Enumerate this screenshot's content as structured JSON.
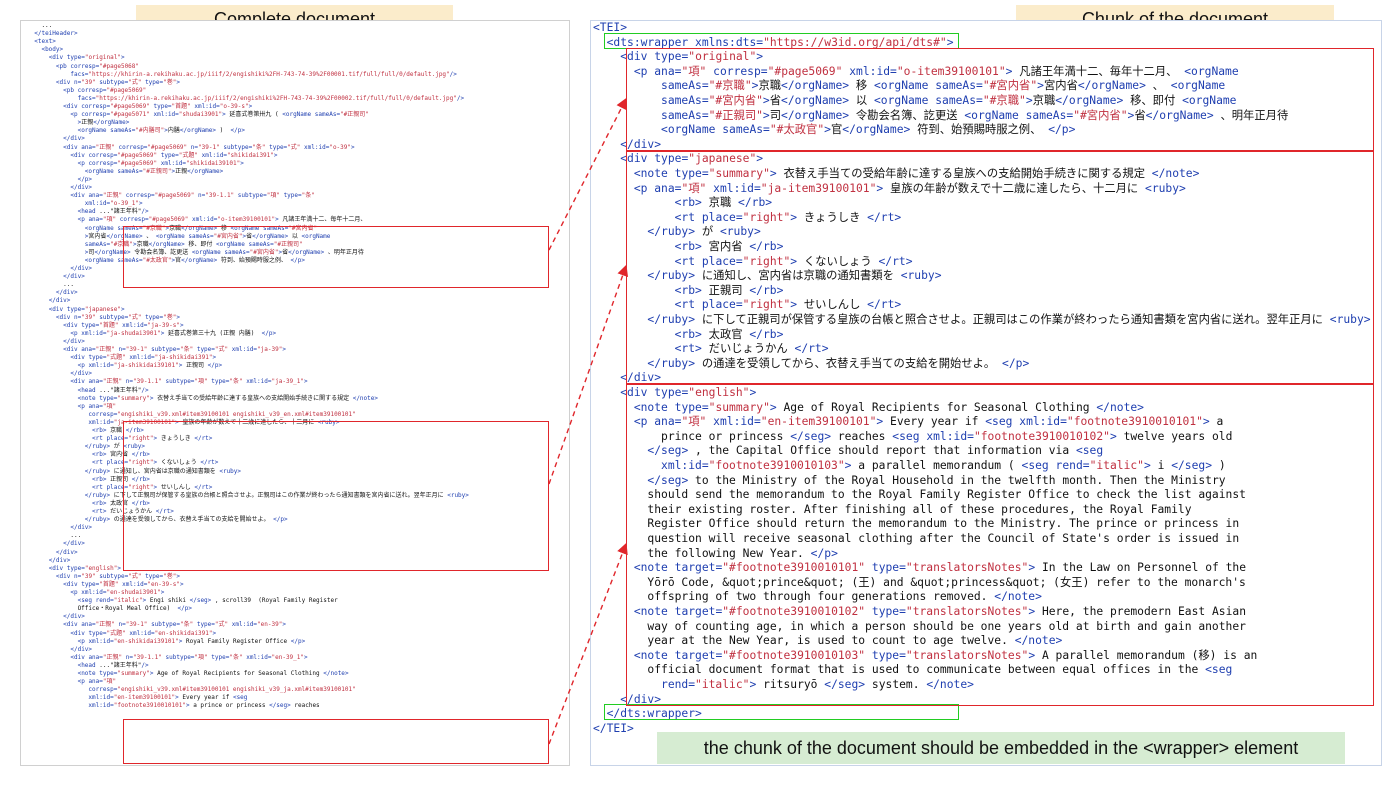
{
  "titles": {
    "left": "Complete document",
    "right": "Chunk of the document"
  },
  "caption": "the chunk of the document should be embedded in the <wrapper> element",
  "colors": {
    "highlight_box": "#e0262b",
    "wrapper_box": "#22cc22",
    "title_bg": "#fbeccb",
    "caption_bg": "#d6ecd2",
    "tag": "#1f3fb0",
    "attr_value": "#c03040"
  },
  "left_lines": [
    "    ...",
    "  </teiHeader>",
    "  <text>",
    "    <body>",
    "      <div type=\"original\">",
    "        <pb corresp=\"#page5068\"",
    "            facs=\"https://khirin-a.rekihaku.ac.jp/iiif/2/engishiki%2FH-743-74-39%2F00001.tif/full/full/0/default.jpg\"/>",
    "        <div n=\"39\" subtype=\"式\" type=\"巻\">",
    "          <pb corresp=\"#page5069\"",
    "              facs=\"https://khirin-a.rekihaku.ac.jp/iiif/2/engishiki%2FH-743-74-39%2F00002.tif/full/full/0/default.jpg\"/>",
    "          <div corresp=\"#page5069\" type=\"首題\" xml:id=\"o-39-s\">",
    "            <p corresp=\"#page5071\" xml:id=\"shudai3901\"> 延喜式巻第卅九 ( <orgName sameAs=\"#正親司\"",
    "              >正親</orgName>",
    "              <orgName sameAs=\"#内膳司\">内膳</orgName> )  </p>",
    "          </div>",
    "          <div ana=\"正親\" corresp=\"#page5069\" n=\"39-1\" subtype=\"条\" type=\"式\" xml:id=\"o-39\">",
    "            <div corresp=\"#page5069\" type=\"式題\" xml:id=\"shikidai391\">",
    "              <p corresp=\"#page5069\" xml:id=\"shikidai39101\">",
    "                <orgName sameAs=\"#正親司\">正親</orgName>",
    "              </p>",
    "            </div>",
    "            <div ana=\"正親\" corresp=\"#page5069\" n=\"39-1.1\" subtype=\"項\" type=\"条\"",
    "                xml:id=\"o-39_1\">",
    "              <head ...\"諸王年料\"/>",
    "              <p ana=\"項\" corresp=\"#page5069\" xml:id=\"o-item39100101\"> 凡諸王年満十二、毎年十二月、",
    "                <orgName sameAs=\"#京職\">京職</orgName> 移 <orgName sameAs=\"#宮内省\"",
    "                >宮内省</orgName> 、 <orgName sameAs=\"#宮内省\">省</orgName> 以 <orgName",
    "                sameAs=\"#京職\">京職</orgName> 移、即付 <orgName sameAs=\"#正親司\"",
    "                >司</orgName> 令勘会名簿、訖更送 <orgName sameAs=\"#宮内省\">省</orgName> 、明年正月待",
    "                <orgName sameAs=\"#太政官\">官</orgName> 符到、始預賜時服之例、 </p>",
    "            </div>",
    "          </div>",
    "          ...",
    "        </div>",
    "      </div>",
    "      <div type=\"japanese\">",
    "        <div n=\"39\" subtype=\"式\" type=\"巻\">",
    "          <div type=\"首題\" xml:id=\"ja-39-s\">",
    "            <p xml:id=\"ja-shudai3901\"> 延喜式巻第三十九 (正親 内膳)  </p>",
    "          </div>",
    "          <div ana=\"正親\" n=\"39-1\" subtype=\"条\" type=\"式\" xml:id=\"ja-39\">",
    "            <div type=\"式題\" xml:id=\"ja-shikidai391\">",
    "              <p xml:id=\"ja-shikidai39101\"> 正親司 </p>",
    "            </div>",
    "            <div ana=\"正親\" n=\"39-1.1\" subtype=\"項\" type=\"条\" xml:id=\"ja-39_1\">",
    "              <head ...\"諸王年料\"/>",
    "              <note type=\"summary\"> 衣替え手当ての受給年齢に達する皇族への支給開始手続きに関する規定 </note>",
    "              <p ana=\"項\"",
    "                 corresp=\"engishiki_v39.xml#item39100101 engishiki_v39_en.xml#item39100101\"",
    "                 xml:id=\"ja-item39100101\"> 皇族の年齢が数えで十二歳に達したら、十二月に <ruby>",
    "                  <rb> 京職 </rb>",
    "                  <rt place=\"right\"> きょうしき </rt>",
    "                </ruby> が <ruby>",
    "                  <rb> 宮内省 </rb>",
    "                  <rt place=\"right\"> くないしょう </rt>",
    "                </ruby> に通知し、宮内省は京職の通知書類を <ruby>",
    "                  <rb> 正親司 </rb>",
    "                  <rt place=\"right\"> せいしんし </rt>",
    "                </ruby> に下して正親司が保管する皇族の台帳と照合させよ。正親司はこの作業が終わったら通知書類を宮内省に送れ。翌年正月に <ruby>",
    "                  <rb> 太政官 </rb>",
    "                  <rt> だいじょうかん </rt>",
    "                </ruby> の通達を受領してから、衣替え手当ての支給を開始せよ。 </p>",
    "            </div>",
    "            ...",
    "          </div>",
    "        </div>",
    "      </div>",
    "      <div type=\"english\">",
    "        <div n=\"39\" subtype=\"式\" type=\"巻\">",
    "          <div type=\"首題\" xml:id=\"en-39-s\">",
    "            <p xml:id=\"en-shudai3901\">",
    "              <seg rend=\"italic\"> Engi shiki </seg> , scroll39  (Royal Family Register",
    "              Office・Royal Meal Office)  </p>",
    "          </div>",
    "          <div ana=\"正親\" n=\"39-1\" subtype=\"条\" type=\"式\" xml:id=\"en-39\">",
    "            <div type=\"式題\" xml:id=\"en-shikidai391\">",
    "              <p xml:id=\"en-shikidai39101\"> Royal Family Register Office </p>",
    "            </div>",
    "            <div ana=\"正親\" n=\"39-1.1\" subtype=\"項\" type=\"条\" xml:id=\"en-39_1\">",
    "              <head ...\"諸王年料\"/>",
    "              <note type=\"summary\"> Age of Royal Recipients for Seasonal Clothing </note>",
    "              <p ana=\"項\"",
    "                 corresp=\"engishiki_v39.xml#item39100101 engishiki_v39_ja.xml#item39100101\"",
    "                 xml:id=\"en-item39100101\"> Every year if <seg",
    "                 xml:id=\"footnote3910010101\"> a prince or princess </seg> reaches"
  ],
  "right_lines": [
    "<TEI>",
    "  <dts:wrapper xmlns:dts=\"https://w3id.org/api/dts#\">",
    "    <div type=\"original\">",
    "      <p ana=\"項\" corresp=\"#page5069\" xml:id=\"o-item39100101\"> 凡諸王年満十二、毎年十二月、 <orgName",
    "          sameAs=\"#京職\">京職</orgName> 移 <orgName sameAs=\"#宮内省\">宮内省</orgName> 、 <orgName",
    "          sameAs=\"#宮内省\">省</orgName> 以 <orgName sameAs=\"#京職\">京職</orgName> 移、即付 <orgName",
    "          sameAs=\"#正親司\">司</orgName> 令勘会名簿、訖更送 <orgName sameAs=\"#宮内省\">省</orgName> 、明年正月待",
    "          <orgName sameAs=\"#太政官\">官</orgName> 符到、始預賜時服之例、 </p>",
    "    </div>",
    "    <div type=\"japanese\">",
    "      <note type=\"summary\"> 衣替え手当ての受給年齢に達する皇族への支給開始手続きに関する規定 </note>",
    "      <p ana=\"項\" xml:id=\"ja-item39100101\"> 皇族の年齢が数えで十二歳に達したら、十二月に <ruby>",
    "            <rb> 京職 </rb>",
    "            <rt place=\"right\"> きょうしき </rt>",
    "        </ruby> が <ruby>",
    "            <rb> 宮内省 </rb>",
    "            <rt place=\"right\"> くないしょう </rt>",
    "        </ruby> に通知し、宮内省は京職の通知書類を <ruby>",
    "            <rb> 正親司 </rb>",
    "            <rt place=\"right\"> せいしんし </rt>",
    "        </ruby> に下して正親司が保管する皇族の台帳と照合させよ。正親司はこの作業が終わったら通知書類を宮内省に送れ。翌年正月に <ruby>",
    "            <rb> 太政官 </rb>",
    "            <rt> だいじょうかん </rt>",
    "        </ruby> の通達を受領してから、衣替え手当ての支給を開始せよ。 </p>",
    "    </div>",
    "    <div type=\"english\">",
    "      <note type=\"summary\"> Age of Royal Recipients for Seasonal Clothing </note>",
    "      <p ana=\"項\" xml:id=\"en-item39100101\"> Every year if <seg xml:id=\"footnote3910010101\"> a",
    "          prince or princess </seg> reaches <seg xml:id=\"footnote3910010102\"> twelve years old",
    "        </seg> , the Capital Office should report that information via <seg",
    "          xml:id=\"footnote3910010103\"> a parallel memorandum ( <seg rend=\"italic\"> i </seg> )",
    "        </seg> to the Ministry of the Royal Household in the twelfth month. Then the Ministry",
    "        should send the memorandum to the Royal Family Register Office to check the list against",
    "        their existing roster. After finishing all of these procedures, the Royal Family",
    "        Register Office should return the memorandum to the Ministry. The prince or princess in",
    "        question will receive seasonal clothing after the Council of State's order is issued in",
    "        the following New Year. </p>",
    "      <note target=\"#footnote3910010101\" type=\"translatorsNotes\"> In the Law on Personnel of the",
    "        Yōrō Code, &quot;prince&quot; (王) and &quot;princess&quot; (女王) refer to the monarch's",
    "        offspring of two through four generations removed. </note>",
    "      <note target=\"#footnote3910010102\" type=\"translatorsNotes\"> Here, the premodern East Asian",
    "        way of counting age, in which a person should be one years old at birth and gain another",
    "        year at the New Year, is used to count to age twelve. </note>",
    "      <note target=\"#footnote3910010103\" type=\"translatorsNotes\"> A parallel memorandum (移) is an",
    "        official document format that is used to communicate between equal offices in the <seg",
    "          rend=\"italic\"> ritsuryō </seg> system. </note>",
    "    </div>",
    "  </dts:wrapper>",
    "</TEI>"
  ]
}
